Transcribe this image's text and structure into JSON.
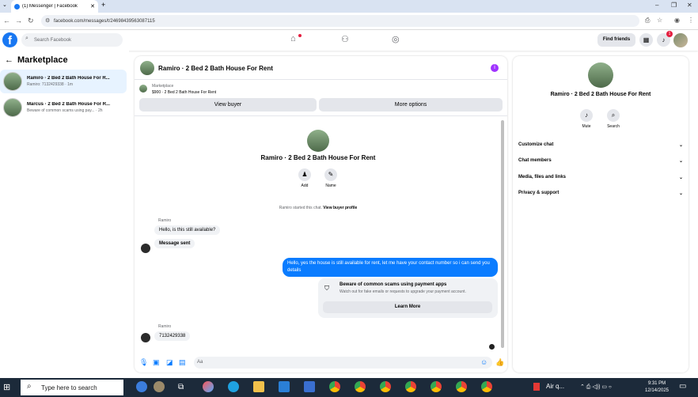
{
  "browser": {
    "tab_title": "(1) Messenger | Facebook",
    "url": "facebook.com/messages/t/24698439563087115",
    "new_tab": "+"
  },
  "fb": {
    "search_placeholder": "Search Facebook",
    "find_friends": "Find friends",
    "notif_count": "1"
  },
  "left": {
    "title": "Marketplace",
    "convos": [
      {
        "title": "Ramiro · 2 Bed 2 Bath House For R...",
        "preview": "Ramiro: 7132429338 · 1m"
      },
      {
        "title": "Marcus · 2 Bed 2 Bath House For R...",
        "preview": "Beware of common scams using pay... · 2h"
      }
    ]
  },
  "chat": {
    "title": "Ramiro · 2 Bed 2 Bath House For Rent",
    "marketplace_label": "Marketplace",
    "listing": "$900 · 2 Bed 2 Bath House For Rent",
    "view_buyer": "View buyer",
    "more_options": "More options",
    "profile_name": "Ramiro · 2 Bed 2 Bath House For Rent",
    "add_label": "Add",
    "name_label": "Name",
    "started_text": "Ramiro started this chat.",
    "view_profile": "View buyer profile",
    "sender1": "Ramiro",
    "msg1": "Hello, is this still available?",
    "msg2": "Message sent",
    "outgoing": "Hello, yes the house is still available for rent, let me have your contact number so i can send you  details",
    "warn_title": "Beware of common scams using payment apps",
    "warn_sub": "Watch out for fake emails or requests to upgrade your payment account.",
    "learn_more": "Learn More",
    "sender2": "Ramiro",
    "msg3": "7132429338",
    "input_placeholder": "Aa"
  },
  "right": {
    "name": "Ramiro · 2 Bed 2 Bath House For Rent",
    "mute": "Mute",
    "search": "Search",
    "sections": [
      "Customize chat",
      "Chat members",
      "Media, files and links",
      "Privacy & support"
    ]
  },
  "taskbar": {
    "search_placeholder": "Type here to search",
    "weather": "Air q...",
    "time": "9:31 PM",
    "date": "12/14/2025"
  }
}
